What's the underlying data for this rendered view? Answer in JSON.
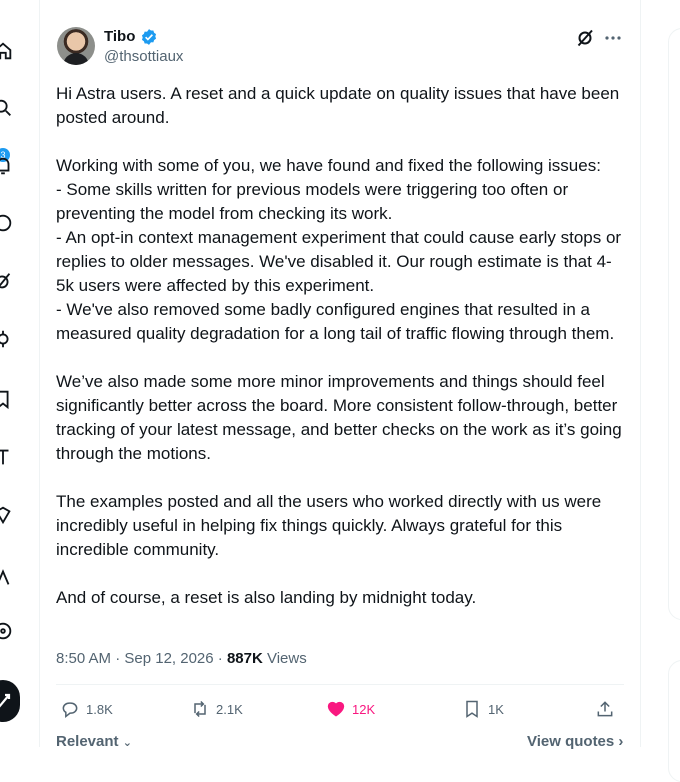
{
  "nav": {
    "badge": "3"
  },
  "post": {
    "author": {
      "name": "Tibo",
      "handle": "@thsottiaux"
    },
    "paragraphs": [
      "Hi Astra users. A reset and a quick update on quality issues that have been posted around.",
      "Working with some of you, we have found and fixed the following issues:\n- Some skills written for previous models were triggering too often or preventing the model from checking its work.\n- An opt-in context management experiment that could cause early stops or replies to older messages. We've disabled it. Our rough estimate is that 4-5k users were affected by this experiment.\n- We've also removed some badly configured engines that resulted in a measured quality degradation for a long tail of traffic flowing through them.",
      "We’ve also made some more minor improvements and things should feel significantly better across the board. More consistent follow-through, better tracking of your latest message, and better checks on the work as it’s going through the motions.",
      "The examples posted and all the users who worked directly with us were incredibly useful in helping fix things quickly. Always grateful for this incredible community.",
      "And of course, a reset is also landing by midnight today."
    ],
    "timestamp": "8:50 AM · Sep 12, 2026 · ",
    "views_count": "887K",
    "views_label": " Views",
    "actions": {
      "replies": "1.8K",
      "reposts": "2.1K",
      "likes": "12K",
      "bookmarks": "1K"
    },
    "footer": {
      "relevant": "Relevant",
      "view_quotes": "View quotes"
    }
  }
}
